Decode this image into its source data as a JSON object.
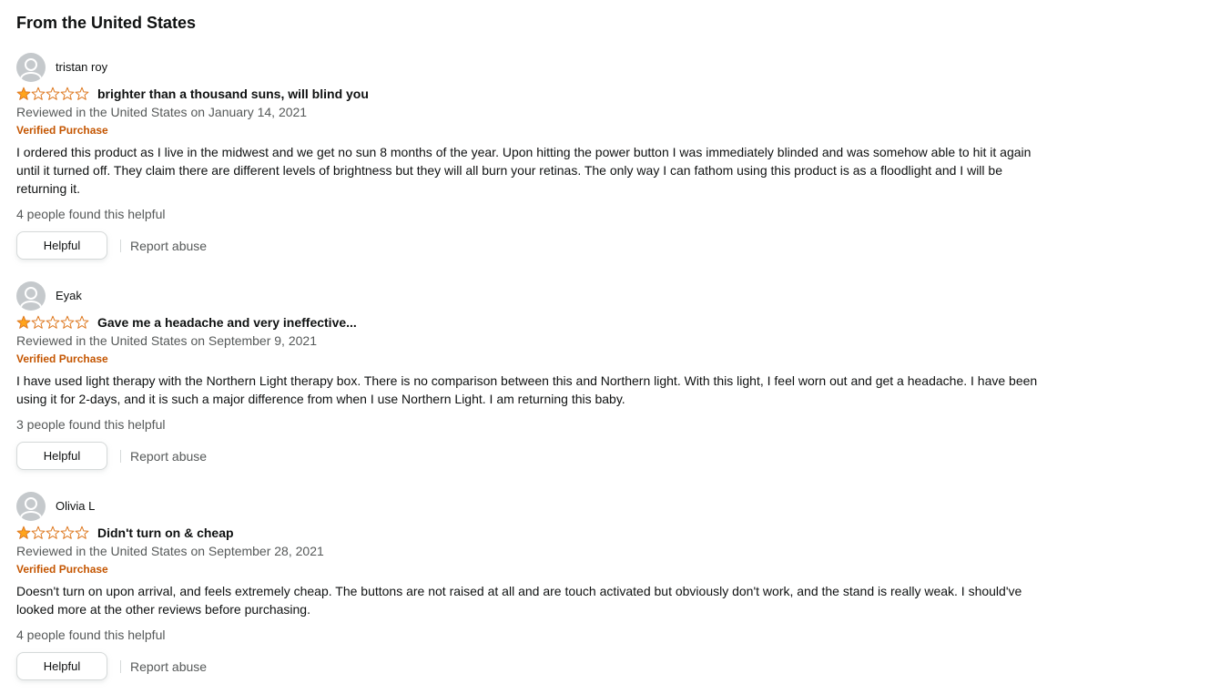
{
  "section": {
    "title": "From the United States"
  },
  "colors": {
    "star_fill": "#FFA41C",
    "star_outline": "#DE7921",
    "verified": "#C45500",
    "muted_text": "#565959"
  },
  "reviews": [
    {
      "profile_name": "tristan roy",
      "rating": 1,
      "rating_max": 5,
      "title": "brighter than a thousand suns, will blind you",
      "date": "Reviewed in the United States on January 14, 2021",
      "verified": "Verified Purchase",
      "body": "I ordered this product as I live in the midwest and we get no sun 8 months of the year. Upon hitting the power button I was immediately blinded and was somehow able to hit it again until it turned off. They claim there are different levels of brightness but they will all burn your retinas. The only way I can fathom using this product is as a floodlight and I will be returning it.",
      "helpful_count": "4 people found this helpful",
      "helpful_label": "Helpful",
      "report_label": "Report abuse"
    },
    {
      "profile_name": "Eyak",
      "rating": 1,
      "rating_max": 5,
      "title": "Gave me a headache and very ineffective...",
      "date": "Reviewed in the United States on September 9, 2021",
      "verified": "Verified Purchase",
      "body": "I have used light therapy with the Northern Light therapy box. There is no comparison between this and Northern light. With this light, I feel worn out and get a headache. I have been using it for 2-days, and it is such a major difference from when I use Northern Light. I am returning this baby.",
      "helpful_count": "3 people found this helpful",
      "helpful_label": "Helpful",
      "report_label": "Report abuse"
    },
    {
      "profile_name": "Olivia L",
      "rating": 1,
      "rating_max": 5,
      "title": "Didn't turn on & cheap",
      "date": "Reviewed in the United States on September 28, 2021",
      "verified": "Verified Purchase",
      "body": "Doesn't turn on upon arrival, and feels extremely cheap. The buttons are not raised at all and are touch activated but obviously don't work, and the stand is really weak. I should've looked more at the other reviews before purchasing.",
      "helpful_count": "4 people found this helpful",
      "helpful_label": "Helpful",
      "report_label": "Report abuse"
    }
  ]
}
